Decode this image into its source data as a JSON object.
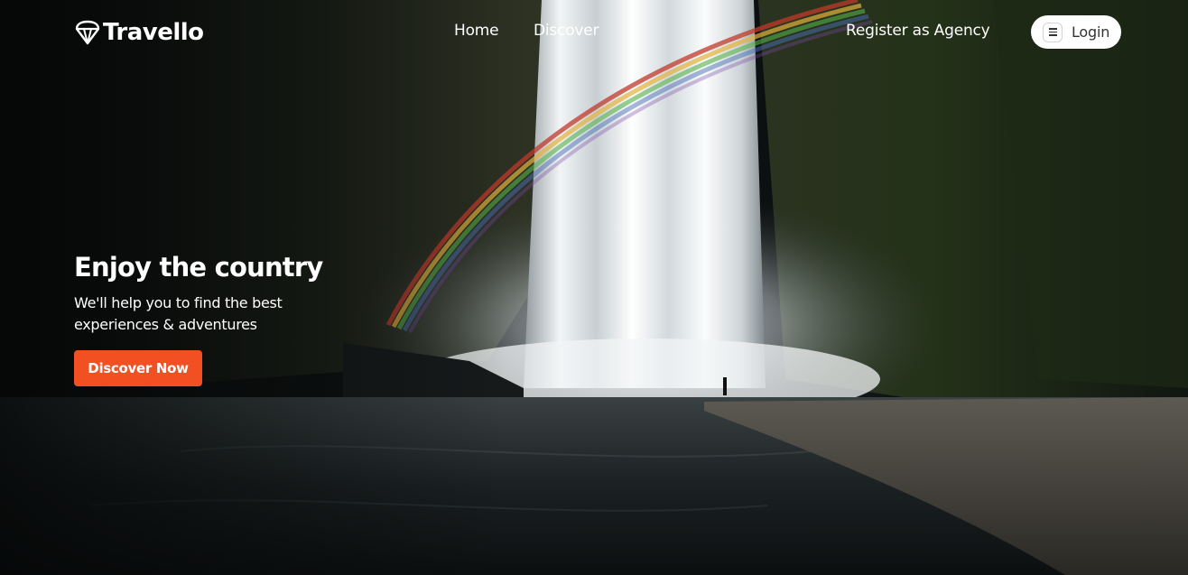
{
  "brand": {
    "name": "Travello"
  },
  "nav": {
    "home": "Home",
    "discover": "Discover",
    "register": "Register as Agency",
    "login": "Login"
  },
  "hero": {
    "title": "Enjoy the country",
    "subtitle": "We'll help you to find the best experiences & adventures",
    "cta": "Discover Now"
  },
  "colors": {
    "accent": "#f25022",
    "text": "#ffffff",
    "background": "#0b0e0e"
  },
  "icons": {
    "brand": "hot-air-balloon-icon",
    "menu": "menu-icon"
  }
}
